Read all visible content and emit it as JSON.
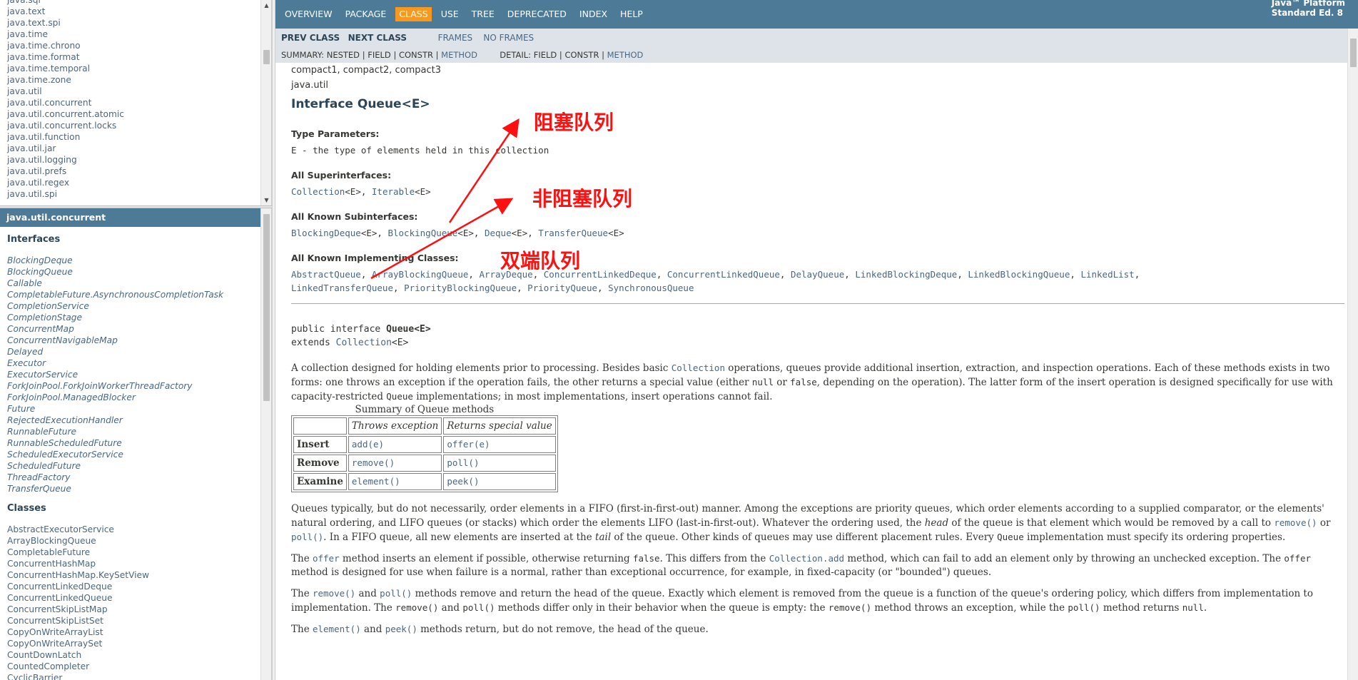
{
  "packages_frame": {
    "items": [
      "java.sql",
      "java.text",
      "java.text.spi",
      "java.time",
      "java.time.chrono",
      "java.time.format",
      "java.time.temporal",
      "java.time.zone",
      "java.util",
      "java.util.concurrent",
      "java.util.concurrent.atomic",
      "java.util.concurrent.locks",
      "java.util.function",
      "java.util.jar",
      "java.util.logging",
      "java.util.prefs",
      "java.util.regex",
      "java.util.spi"
    ]
  },
  "classes_frame": {
    "header": "java.util.concurrent",
    "interfaces_title": "Interfaces",
    "interfaces": [
      "BlockingDeque",
      "BlockingQueue",
      "Callable",
      "CompletableFuture.AsynchronousCompletionTask",
      "CompletionService",
      "CompletionStage",
      "ConcurrentMap",
      "ConcurrentNavigableMap",
      "Delayed",
      "Executor",
      "ExecutorService",
      "ForkJoinPool.ForkJoinWorkerThreadFactory",
      "ForkJoinPool.ManagedBlocker",
      "Future",
      "RejectedExecutionHandler",
      "RunnableFuture",
      "RunnableScheduledFuture",
      "ScheduledExecutorService",
      "ScheduledFuture",
      "ThreadFactory",
      "TransferQueue"
    ],
    "classes_title": "Classes",
    "classes": [
      "AbstractExecutorService",
      "ArrayBlockingQueue",
      "CompletableFuture",
      "ConcurrentHashMap",
      "ConcurrentHashMap.KeySetView",
      "ConcurrentLinkedDeque",
      "ConcurrentLinkedQueue",
      "ConcurrentSkipListMap",
      "ConcurrentSkipListSet",
      "CopyOnWriteArrayList",
      "CopyOnWriteArraySet",
      "CountDownLatch",
      "CountedCompleter",
      "CyclicBarrier"
    ]
  },
  "topnav": {
    "items": [
      {
        "label": "OVERVIEW",
        "active": false
      },
      {
        "label": "PACKAGE",
        "active": false
      },
      {
        "label": "CLASS",
        "active": true
      },
      {
        "label": "USE",
        "active": false
      },
      {
        "label": "TREE",
        "active": false
      },
      {
        "label": "DEPRECATED",
        "active": false
      },
      {
        "label": "INDEX",
        "active": false
      },
      {
        "label": "HELP",
        "active": false
      }
    ],
    "platform_line1": "Java™ Platform",
    "platform_line2": "Standard Ed. 8"
  },
  "subnav": {
    "prev_class": "PREV CLASS",
    "next_class": "NEXT CLASS",
    "frames": "FRAMES",
    "no_frames": "NO FRAMES",
    "summary_label": "SUMMARY:",
    "summary_nested": "NESTED",
    "summary_field": "FIELD",
    "summary_constr": "CONSTR",
    "summary_method": "METHOD",
    "detail_label": "DETAIL:",
    "detail_field": "FIELD",
    "detail_constr": "CONSTR",
    "detail_method": "METHOD",
    "sep": "|"
  },
  "content": {
    "profiles": "compact1, compact2, compact3",
    "package": "java.util",
    "title": "Interface Queue<E>",
    "type_params_label": "Type Parameters:",
    "type_params_value": "E - the type of elements held in this collection",
    "superinterfaces_label": "All Superinterfaces:",
    "superinterfaces": [
      {
        "name": "Collection",
        "generic": "<E>",
        "sep": ", "
      },
      {
        "name": "Iterable",
        "generic": "<E>",
        "sep": ""
      }
    ],
    "subinterfaces_label": "All Known Subinterfaces:",
    "subinterfaces": [
      {
        "name": "BlockingDeque",
        "generic": "<E>",
        "sep": ", "
      },
      {
        "name": "BlockingQueue",
        "generic": "<E>",
        "sep": ", "
      },
      {
        "name": "Deque",
        "generic": "<E>",
        "sep": ", "
      },
      {
        "name": "TransferQueue",
        "generic": "<E>",
        "sep": ""
      }
    ],
    "implementing_label": "All Known Implementing Classes:",
    "implementing_line1": [
      "AbstractQueue",
      "ArrayBlockingQueue",
      "ArrayDeque",
      "ConcurrentLinkedDeque",
      "ConcurrentLinkedQueue",
      "DelayQueue",
      "LinkedBlockingDeque",
      "LinkedBlockingQueue",
      "LinkedList"
    ],
    "implementing_line2": [
      "LinkedTransferQueue",
      "PriorityBlockingQueue",
      "PriorityQueue",
      "SynchronousQueue"
    ],
    "decl_line1_prefix": "public interface ",
    "decl_line1_name": "Queue<E>",
    "decl_line2_prefix": "extends ",
    "decl_line2_link": "Collection",
    "decl_line2_suffix": "<E>",
    "para1_a": "A collection designed for holding elements prior to processing. Besides basic ",
    "para1_code": "Collection",
    "para1_b": " operations, queues provide additional insertion, extraction, and inspection operations. Each of these methods exists in two forms: one throws an exception if the operation fails, the other returns a special value (either ",
    "para1_null": "null",
    "para1_or": " or ",
    "para1_false": "false",
    "para1_c": ", depending on the operation). The latter form of the insert operation is designed specifically for use with capacity-restricted ",
    "para1_queue": "Queue",
    "para1_d": " implementations; in most implementations, insert operations cannot fail.",
    "table": {
      "caption": "Summary of Queue methods",
      "col1": "Throws exception",
      "col2": "Returns special value",
      "rows": [
        {
          "label": "Insert",
          "a": "add(e)",
          "b": "offer(e)"
        },
        {
          "label": "Remove",
          "a": "remove()",
          "b": "poll()"
        },
        {
          "label": "Examine",
          "a": "element()",
          "b": "peek()"
        }
      ]
    },
    "para2_a": "Queues typically, but do not necessarily, order elements in a FIFO (first-in-first-out) manner. Among the exceptions are priority queues, which order elements according to a supplied comparator, or the elements' natural ordering, and LIFO queues (or stacks) which order the elements LIFO (last-in-first-out). Whatever the ordering used, the ",
    "para2_head": "head",
    "para2_b": " of the queue is that element which would be removed by a call to ",
    "para2_remove": "remove()",
    "para2_or": " or ",
    "para2_poll": "poll()",
    "para2_c": ". In a FIFO queue, all new elements are inserted at the ",
    "para2_tail": "tail",
    "para2_d": " of the queue. Other kinds of queues may use different placement rules. Every ",
    "para2_queue": "Queue",
    "para2_e": " implementation must specify its ordering properties.",
    "para3_a": "The ",
    "para3_offer": "offer",
    "para3_b": " method inserts an element if possible, otherwise returning ",
    "para3_false": "false",
    "para3_c": ". This differs from the ",
    "para3_add": "Collection.add",
    "para3_d": " method, which can fail to add an element only by throwing an unchecked exception. The ",
    "para3_offer2": "offer",
    "para3_e": " method is designed for use when failure is a normal, rather than exceptional occurrence, for example, in fixed-capacity (or \"bounded\") queues.",
    "para4_a": "The ",
    "para4_remove": "remove()",
    "para4_and": " and ",
    "para4_poll": "poll()",
    "para4_b": " methods remove and return the head of the queue. Exactly which element is removed from the queue is a function of the queue's ordering policy, which differs from implementation to implementation. The ",
    "para4_remove2": "remove()",
    "para4_and2": " and ",
    "para4_poll2": "poll()",
    "para4_c": " methods differ only in their behavior when the queue is empty: the ",
    "para4_remove3": "remove()",
    "para4_d": " method throws an exception, while the ",
    "para4_poll3": "poll()",
    "para4_e": " method returns ",
    "para4_null": "null",
    "para4_f": ".",
    "para5_a": "The ",
    "para5_element": "element()",
    "para5_and": " and ",
    "para5_peek": "peek()",
    "para5_b": " methods return, but do not remove, the head of the queue."
  },
  "annotations": {
    "blocking": "阻塞队列",
    "nonblocking": "非阻塞队列",
    "deque": "双端队列",
    "color": "#ff1010"
  },
  "colors": {
    "nav_bg": "#4d7a97",
    "subnav_bg": "#dee3e9",
    "active_tab": "#f8981d",
    "link": "#4a6782"
  }
}
